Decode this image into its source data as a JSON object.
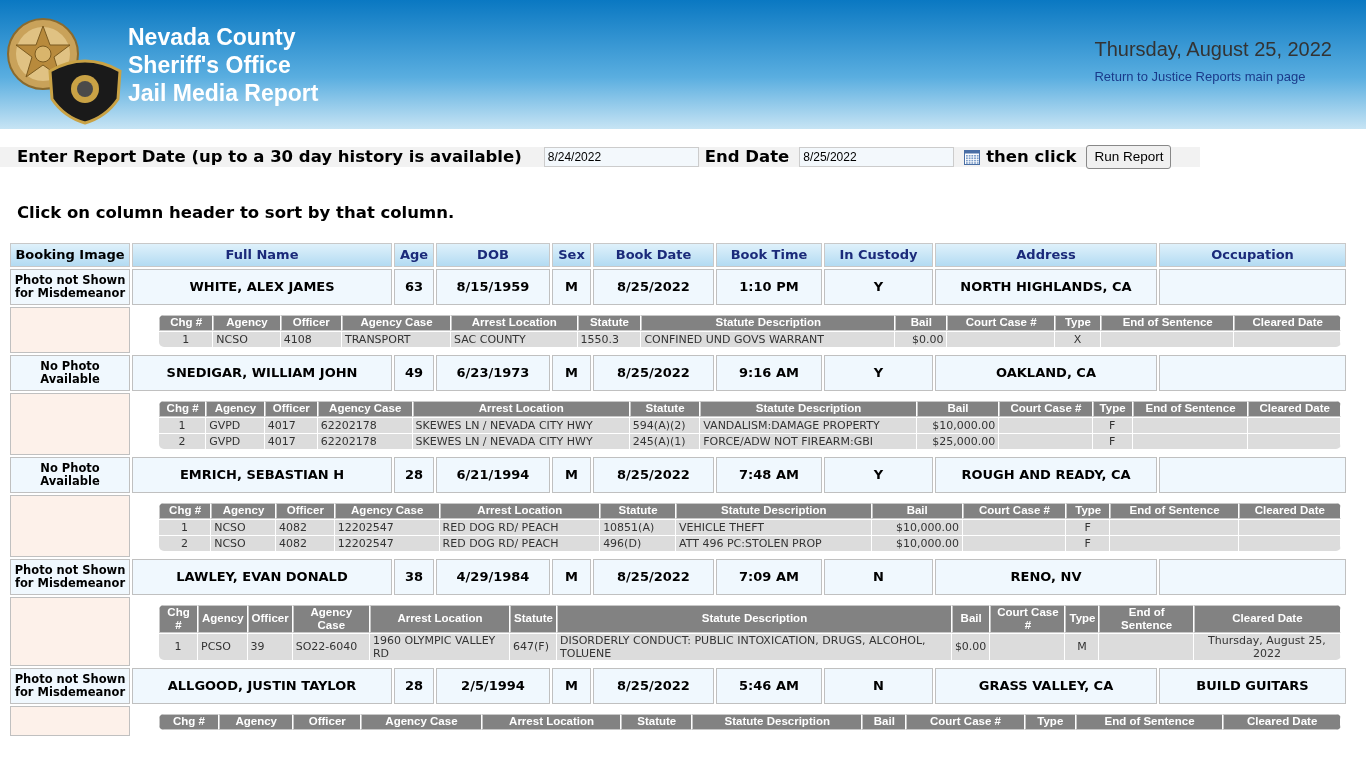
{
  "header": {
    "title_lines": [
      "Nevada County",
      "Sheriff's Office",
      "Jail Media Report"
    ],
    "date": "Thursday, August 25, 2022",
    "link": "Return to Justice Reports main page"
  },
  "form": {
    "start_label": "Enter Report Date (up to a 30 day history is available)",
    "start_value": "8/24/2022",
    "end_label": "End Date",
    "end_value": "8/25/2022",
    "then_label": "then click",
    "button": "Run Report"
  },
  "instruction": "Click on column header to sort by that column.",
  "table": {
    "columns": [
      "Booking Image",
      "Full Name",
      "Age",
      "DOB",
      "Sex",
      "Book Date",
      "Book Time",
      "In Custody",
      "Address",
      "Occupation"
    ]
  },
  "bookings": [
    {
      "image_note": "Photo not Shown for Misdemeanor",
      "name": "WHITE, ALEX JAMES",
      "age": "63",
      "dob": "8/15/1959",
      "sex": "M",
      "book_date": "8/25/2022",
      "book_time": "1:10 PM",
      "in_custody": "Y",
      "address": "NORTH HIGHLANDS, CA",
      "charge_columns": [
        "Chg #",
        "Agency",
        "Officer",
        "Agency Case",
        "Arrest Location",
        "Statute",
        "Statute Description",
        "Bail",
        "Court Case #",
        "Type",
        "End of Sentence",
        "Cleared Date"
      ],
      "charges": [
        {
          "chg": "1",
          "agency": "NCSO",
          "officer": "4108",
          "agency_case": "TRANSPORT",
          "arrest_location": "SAC COUNTY",
          "statute": "1550.3",
          "description": "CONFINED UND GOVS WARRANT",
          "bail": "$0.00",
          "type": "X"
        }
      ]
    },
    {
      "image_note": "No Photo Available",
      "name": "SNEDIGAR, WILLIAM JOHN",
      "age": "49",
      "dob": "6/23/1973",
      "sex": "M",
      "book_date": "8/25/2022",
      "book_time": "9:16 AM",
      "in_custody": "Y",
      "address": "OAKLAND, CA",
      "charge_columns": [
        "Chg #",
        "Agency",
        "Officer",
        "Agency Case",
        "Arrest Location",
        "Statute",
        "Statute Description",
        "Bail",
        "Court Case #",
        "Type",
        "End of Sentence",
        "Cleared Date"
      ],
      "charges": [
        {
          "chg": "1",
          "agency": "GVPD",
          "officer": "4017",
          "agency_case": "62202178",
          "arrest_location": "SKEWES LN / NEVADA CITY HWY",
          "statute": "594(A)(2)",
          "description": "VANDALISM:DAMAGE PROPERTY",
          "bail": "$10,000.00",
          "type": "F"
        },
        {
          "chg": "2",
          "agency": "GVPD",
          "officer": "4017",
          "agency_case": "62202178",
          "arrest_location": "SKEWES LN / NEVADA CITY HWY",
          "statute": "245(A)(1)",
          "description": "FORCE/ADW NOT FIREARM:GBI",
          "bail": "$25,000.00",
          "type": "F"
        }
      ]
    },
    {
      "image_note": "No Photo Available",
      "name": "EMRICH, SEBASTIAN H",
      "age": "28",
      "dob": "6/21/1994",
      "sex": "M",
      "book_date": "8/25/2022",
      "book_time": "7:48 AM",
      "in_custody": "Y",
      "address": "ROUGH AND READY, CA",
      "charge_columns": [
        "Chg #",
        "Agency",
        "Officer",
        "Agency Case",
        "Arrest Location",
        "Statute",
        "Statute Description",
        "Bail",
        "Court Case #",
        "Type",
        "End of Sentence",
        "Cleared Date"
      ],
      "charges": [
        {
          "chg": "1",
          "agency": "NCSO",
          "officer": "4082",
          "agency_case": "12202547",
          "arrest_location": "RED DOG RD/ PEACH",
          "statute": "10851(A)",
          "description": "VEHICLE THEFT",
          "bail": "$10,000.00",
          "type": "F"
        },
        {
          "chg": "2",
          "agency": "NCSO",
          "officer": "4082",
          "agency_case": "12202547",
          "arrest_location": "RED DOG RD/ PEACH",
          "statute": "496(D)",
          "description": "ATT 496 PC:STOLEN PROP",
          "bail": "$10,000.00",
          "type": "F"
        }
      ]
    },
    {
      "image_note": "Photo not Shown for Misdemeanor",
      "name": "LAWLEY, EVAN DONALD",
      "age": "38",
      "dob": "4/29/1984",
      "sex": "M",
      "book_date": "8/25/2022",
      "book_time": "7:09 AM",
      "in_custody": "N",
      "address": "RENO, NV",
      "charge_columns": [
        "Chg #",
        "Agency",
        "Officer",
        "Agency Case",
        "Arrest Location",
        "Statute",
        "Statute Description",
        "Bail",
        "Court Case #",
        "Type",
        "End of Sentence",
        "Cleared Date"
      ],
      "charges": [
        {
          "chg": "1",
          "agency": "PCSO",
          "officer": "39",
          "agency_case": "SO22-6040",
          "arrest_location": "1960 OLYMPIC VALLEY RD",
          "statute": "647(F)",
          "description": "DISORDERLY CONDUCT: PUBLIC INTOXICATION, DRUGS, ALCOHOL, TOLUENE",
          "bail": "$0.00",
          "type": "M",
          "cleared_date": "Thursday, August 25, 2022"
        }
      ]
    },
    {
      "image_note": "Photo not Shown for Misdemeanor",
      "name": "ALLGOOD, JUSTIN TAYLOR",
      "age": "28",
      "dob": "2/5/1994",
      "sex": "M",
      "book_date": "8/25/2022",
      "book_time": "5:46 AM",
      "in_custody": "N",
      "address": "GRASS VALLEY, CA",
      "occupation": "BUILD GUITARS",
      "charge_columns": [
        "Chg #",
        "Agency",
        "Officer",
        "Agency Case",
        "Arrest Location",
        "Statute",
        "Statute Description",
        "Bail",
        "Court Case #",
        "Type",
        "End of Sentence",
        "Cleared Date"
      ]
    }
  ]
}
